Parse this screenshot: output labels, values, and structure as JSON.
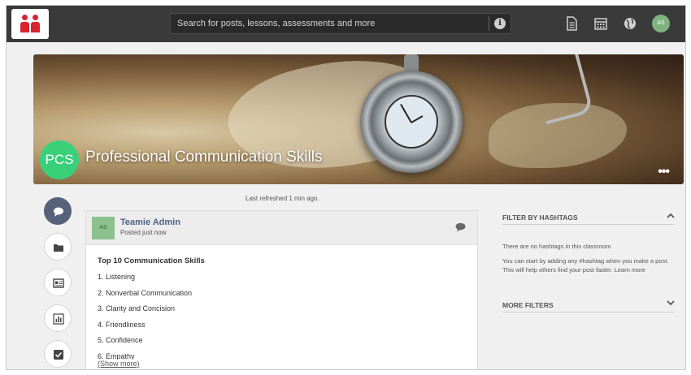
{
  "topbar": {
    "search_placeholder": "Search for posts, lessons, assessments and more",
    "info_icon": "i",
    "avatar_initials": "AS",
    "icons": [
      "document-icon",
      "calendar-icon",
      "globe-icon"
    ]
  },
  "banner": {
    "class_initials": "PCS",
    "class_title": "Professional Communication Skills",
    "more_label": "•••"
  },
  "feed": {
    "last_refreshed": "Last refreshed 1 min ago."
  },
  "sidenav": [
    "chat-icon",
    "folder-icon",
    "lessons-icon",
    "chart-icon",
    "checkbox-icon"
  ],
  "post": {
    "avatar_initials": "AS",
    "author": "Teamie Admin",
    "posted": "Posted just now",
    "heading": "Top 10 Communication Skills",
    "lines": [
      "1. Listening",
      "2. Nonverbal Communication",
      "3. Clarity and Concision",
      "4. Friendliness",
      "5. Confidence",
      "6. Empathy"
    ],
    "show_more": "(Show more)"
  },
  "filters": {
    "hashtags_title": "FILTER BY HASHTAGS",
    "no_hashtags": "There are no hashtags in this classroom",
    "hint": "You can start by adding any #hashtag when you make a post. This will help others find your post faster.",
    "learn_more": "Learn more",
    "more_filters_title": "MORE FILTERS"
  },
  "colors": {
    "topbar": "#3a3a3a",
    "brand_red": "#d9232e",
    "class_badge": "#39d07a",
    "author_link": "#4d6186",
    "active_nav": "#55627a"
  }
}
